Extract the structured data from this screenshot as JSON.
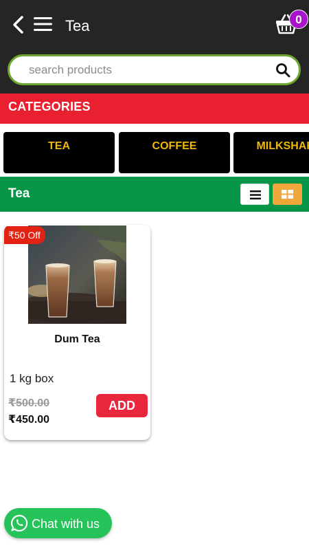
{
  "header": {
    "title": "Tea",
    "cart_count": "0"
  },
  "search": {
    "placeholder": "search products"
  },
  "categories": {
    "heading": "CATEGORIES",
    "items": [
      {
        "label": "TEA"
      },
      {
        "label": "COFFEE"
      },
      {
        "label": "MILKSHAKE"
      }
    ]
  },
  "section": {
    "title": "Tea"
  },
  "products": [
    {
      "discount": "₹50 Off",
      "name": "Dum Tea",
      "unit": "1 kg box",
      "old_price": "₹500.00",
      "price": "₹450.00",
      "add_label": "ADD"
    }
  ],
  "chat": {
    "label": "Chat with us"
  },
  "colors": {
    "topbar": "#252525",
    "categories_bar": "#e8202f",
    "section_bar": "#079547",
    "category_text": "#f0b70d",
    "add_button": "#e8263c",
    "chat_button": "#26c35a",
    "badge": "#a814c9"
  }
}
